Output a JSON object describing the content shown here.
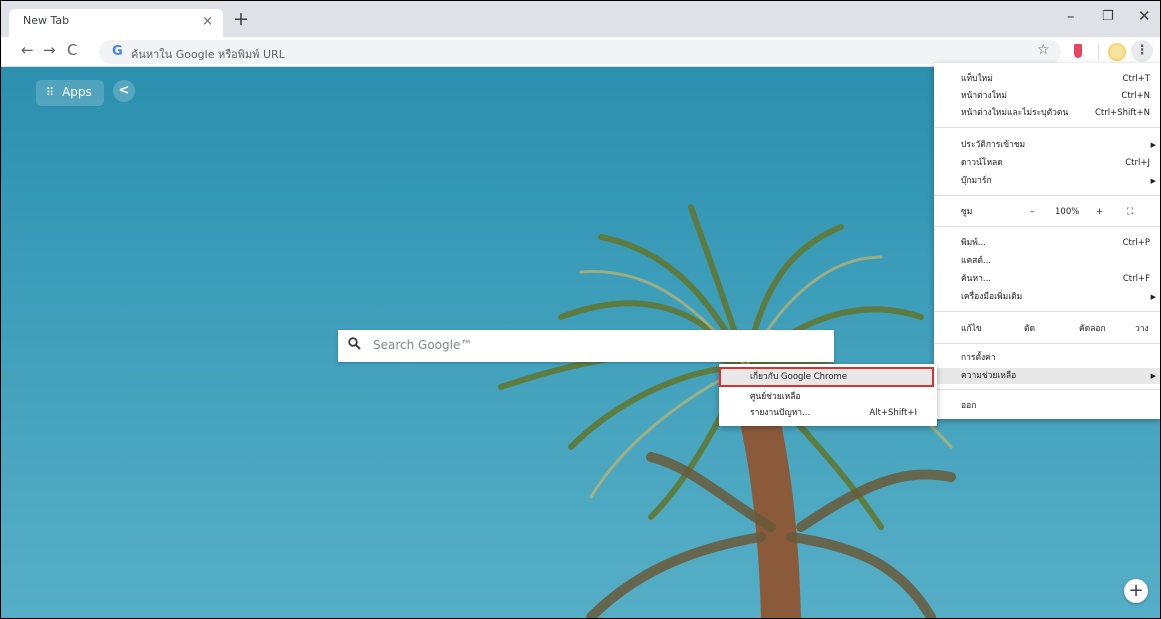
{
  "tab": {
    "title": "New Tab",
    "close": "×",
    "new_tab": "+"
  },
  "window": {
    "minimize": "–",
    "maximize": "❐",
    "close": "✕"
  },
  "toolbar": {
    "back": "←",
    "forward": "→",
    "reload": "C",
    "omnibox_icon": "G",
    "omnibox_placeholder": "ค้นหาใน Google หรือพิมพ์ URL",
    "bookmark_star": "☆",
    "menu_dots": "⋮"
  },
  "content": {
    "apps_label": "Apps",
    "apps_icon": "⠿",
    "share_icon": "<",
    "search_icon": "🔍",
    "search_placeholder": "Search Google™",
    "add_icon": "+"
  },
  "menu": {
    "new_tab": {
      "label": "แท็บใหม่",
      "shortcut": "Ctrl+T"
    },
    "new_window": {
      "label": "หน้าต่างใหม่",
      "shortcut": "Ctrl+N"
    },
    "incognito": {
      "label": "หน้าต่างใหม่และไม่ระบุตัวตน",
      "shortcut": "Ctrl+Shift+N"
    },
    "history": {
      "label": "ประวัติการเข้าชม",
      "arrow": "▶"
    },
    "downloads": {
      "label": "ดาวน์โหลด",
      "shortcut": "Ctrl+J"
    },
    "bookmarks": {
      "label": "บุ๊กมาร์ก",
      "arrow": "▶"
    },
    "zoom": {
      "label": "ซูม",
      "minus": "–",
      "value": "100%",
      "plus": "+",
      "fullscreen": "⛶"
    },
    "print": {
      "label": "พิมพ์...",
      "shortcut": "Ctrl+P"
    },
    "cast": {
      "label": "แคสต์..."
    },
    "find": {
      "label": "ค้นหา...",
      "shortcut": "Ctrl+F"
    },
    "more_tools": {
      "label": "เครื่องมือเพิ่มเติม",
      "arrow": "▶"
    },
    "edit": {
      "label": "แก้ไข",
      "cut": "ตัด",
      "copy": "คัดลอก",
      "paste": "วาง"
    },
    "settings": {
      "label": "การตั้งค่า"
    },
    "help": {
      "label": "ความช่วยเหลือ",
      "arrow": "▶"
    },
    "exit": {
      "label": "ออก"
    }
  },
  "submenu": {
    "about": {
      "label": "เกี่ยวกับ Google Chrome"
    },
    "help_center": {
      "label": "ศูนย์ช่วยเหลือ"
    },
    "report": {
      "label": "รายงานปัญหา...",
      "shortcut": "Alt+Shift+I"
    }
  },
  "colors": {
    "highlight_border": "#e02e2e",
    "sky": "#3a9cb9"
  }
}
